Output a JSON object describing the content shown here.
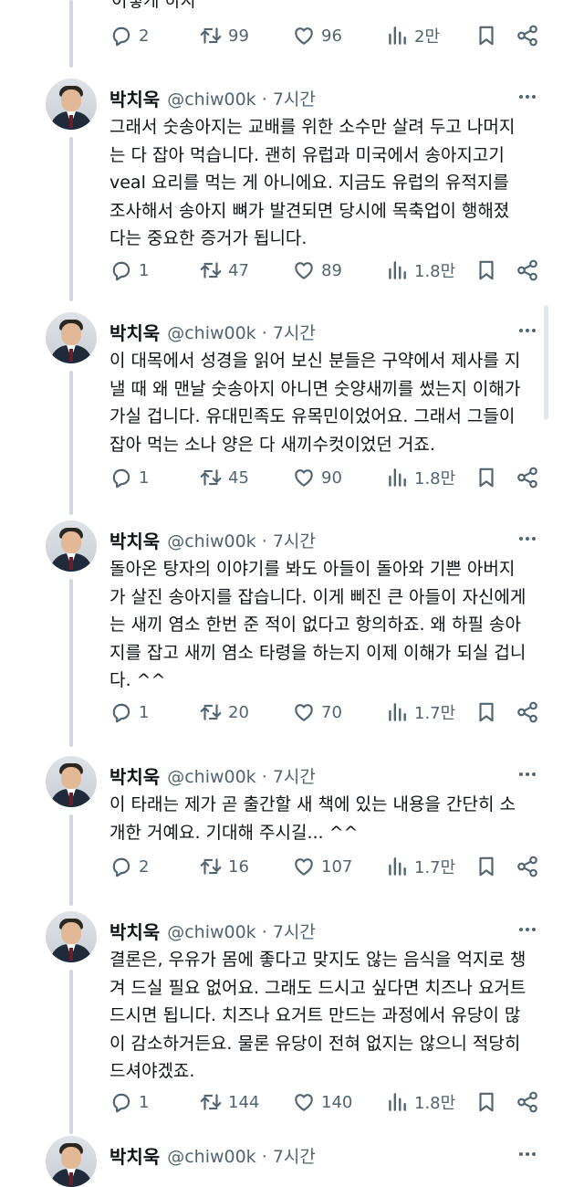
{
  "topCutText": "이렇게 하자",
  "user": {
    "name": "박치욱",
    "handle": "@chiw00k",
    "time": "7시간"
  },
  "topActions": {
    "reply": "2",
    "retweet": "99",
    "like": "96",
    "views": "2만"
  },
  "tweets": [
    {
      "text": "그래서 숫송아지는 교배를 위한 소수만 살려 두고 나머지\n는 다 잡아 먹습니다. 괜히 유럽과 미국에서 송아지고기\nveal 요리를 먹는 게 아니에요. 지금도 유럽의 유적지를\n조사해서 송아지 뼈가 발견되면 당시에 목축업이 행해졌\n다는 중요한 증거가 됩니다.",
      "reply": "1",
      "retweet": "47",
      "like": "89",
      "views": "1.8만"
    },
    {
      "text": "이 대목에서 성경을 읽어 보신 분들은 구약에서 제사를 지\n낼 때 왜 맨날 숫송아지 아니면 숫양새끼를 썼는지 이해가\n가실 겁니다. 유대민족도 유목민이었어요. 그래서 그들이\n잡아 먹는 소나 양은 다 새끼수컷이었던 거죠.",
      "reply": "1",
      "retweet": "45",
      "like": "90",
      "views": "1.8만"
    },
    {
      "text": "돌아온 탕자의 이야기를 봐도 아들이 돌아와 기쁜 아버지\n가 살진 송아지를 잡습니다. 이게 삐진 큰 아들이 자신에게\n는 새끼 염소 한번 준 적이 없다고 항의하죠. 왜 하필 송아\n지를 잡고 새끼 염소 타령을 하는지 이제 이해가 되실 겁니\n다. ^^",
      "reply": "1",
      "retweet": "20",
      "like": "70",
      "views": "1.7만"
    },
    {
      "text": "이 타래는 제가 곧 출간할 새 책에 있는 내용을 간단히 소\n개한 거예요. 기대해 주시길... ^^",
      "reply": "2",
      "retweet": "16",
      "like": "107",
      "views": "1.7만"
    },
    {
      "text": "결론은, 우유가 몸에 좋다고 맞지도 않는 음식을 억지로 챙\n겨 드실 필요 없어요. 그래도 드시고 싶다면 치즈나 요거트\n드시면 됩니다. 치즈나 요거트 만드는 과정에서 유당이 많\n이 감소하거든요. 물론 유당이 전혀 없지는 않으니 적당히\n드셔야겠죠.",
      "reply": "1",
      "retweet": "144",
      "like": "140",
      "views": "1.8만"
    },
    {
      "text": "",
      "reply": "",
      "retweet": "",
      "like": "",
      "views": ""
    }
  ]
}
